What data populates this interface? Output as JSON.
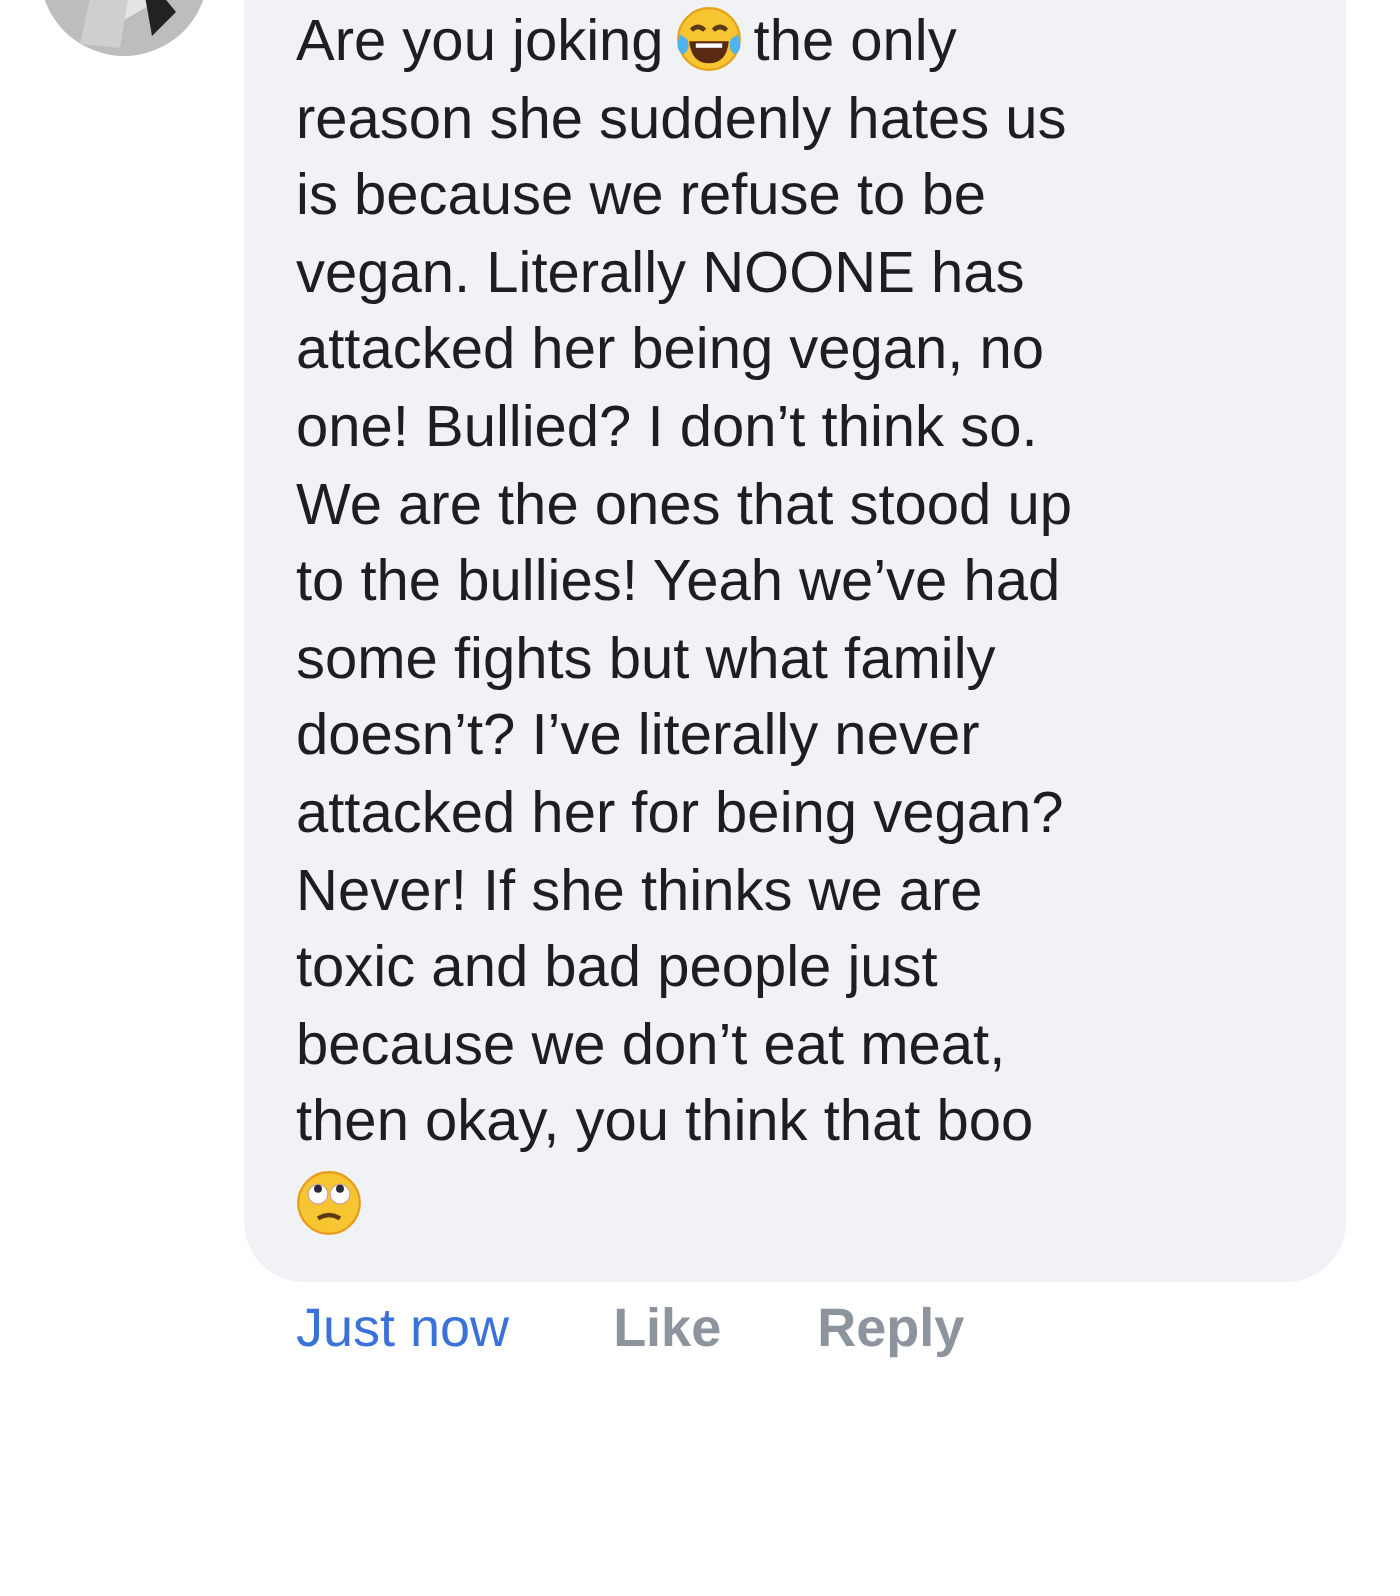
{
  "comment": {
    "segments": [
      {
        "kind": "text",
        "text": "Are you joking"
      },
      {
        "kind": "laughing-emoji"
      },
      {
        "kind": "text",
        "text": "the only"
      },
      {
        "kind": "break"
      },
      {
        "kind": "text",
        "text": "reason she suddenly hates us\nis because we refuse to be\nvegan. Literally NOONE has\nattacked her being vegan, no\none! Bullied? I don’t think so.\nWe are the ones that stood up\nto the bullies! Yeah we’ve had\nsome fights but what family\ndoesn’t? I’ve literally never\nattacked her for being vegan?\nNever! If she thinks we are\ntoxic and bad people just\nbecause we don’t eat meat,\nthen okay, you think that boo"
      },
      {
        "kind": "break"
      },
      {
        "kind": "eye-roll-emoji"
      }
    ]
  },
  "actions": [
    {
      "kind": "time",
      "label": "Just now"
    },
    {
      "kind": "action",
      "label": "Like"
    },
    {
      "kind": "action",
      "label": "Reply"
    }
  ]
}
